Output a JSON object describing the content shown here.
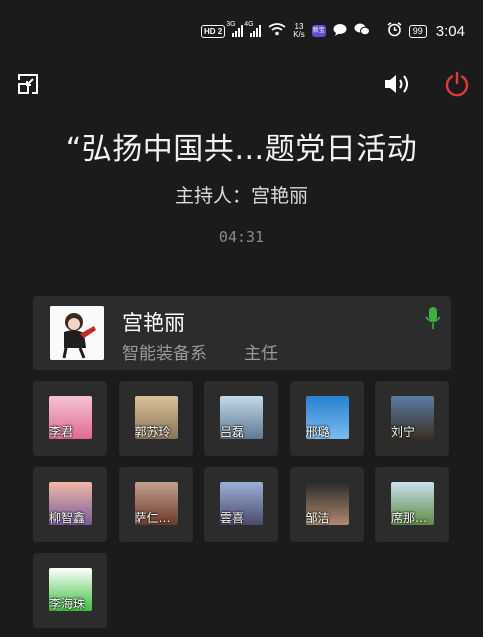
{
  "status_bar": {
    "hd": "HD",
    "hd_sub": "2",
    "signal1": "3G",
    "signal2": "4G",
    "speed_value": "13",
    "speed_unit": "K/s",
    "app_badge": "新宝",
    "battery": "99",
    "time": "3:04"
  },
  "meeting": {
    "title": "“弘扬中国共…题党日活动",
    "host_line": "主持人：宫艳丽",
    "elapsed": "04:31"
  },
  "host_card": {
    "name": "宫艳丽",
    "department": "智能装备系",
    "role": "主任",
    "mic_color": "#3cb043"
  },
  "participants": [
    {
      "name": "李君",
      "thumb": [
        "#f4c4d6",
        "#e06a90"
      ]
    },
    {
      "name": "郭苏玲",
      "thumb": [
        "#d8c39a",
        "#8a7356"
      ]
    },
    {
      "name": "吕磊",
      "thumb": [
        "#c5d9e8",
        "#5d7a94"
      ]
    },
    {
      "name": "邢璐",
      "thumb": [
        "#2a7fd0",
        "#7bbdf0"
      ]
    },
    {
      "name": "刘宁",
      "thumb": [
        "#5a7da3",
        "#3a3022"
      ]
    },
    {
      "name": "柳智鑫",
      "thumb": [
        "#f0b9a8",
        "#7a5b9a"
      ]
    },
    {
      "name": "萨仁…",
      "thumb": [
        "#c4a090",
        "#6a3a2a"
      ]
    },
    {
      "name": "雲喜",
      "thumb": [
        "#9cb0d8",
        "#4a4a6a"
      ]
    },
    {
      "name": "邹洁",
      "thumb": [
        "#2a2a2a",
        "#b08a70"
      ]
    },
    {
      "name": "席那…",
      "thumb": [
        "#c9e0f2",
        "#5f8a3e"
      ]
    },
    {
      "name": "李海珠",
      "thumb": [
        "#ffffff",
        "#3cc03c"
      ]
    }
  ],
  "colors": {
    "background": "#1b1b1b",
    "card": "#2c2c2c",
    "power": "#e53935"
  },
  "icons": {
    "top_left": "minimize-window-icon",
    "speaker": "speaker-icon",
    "power": "power-icon"
  }
}
